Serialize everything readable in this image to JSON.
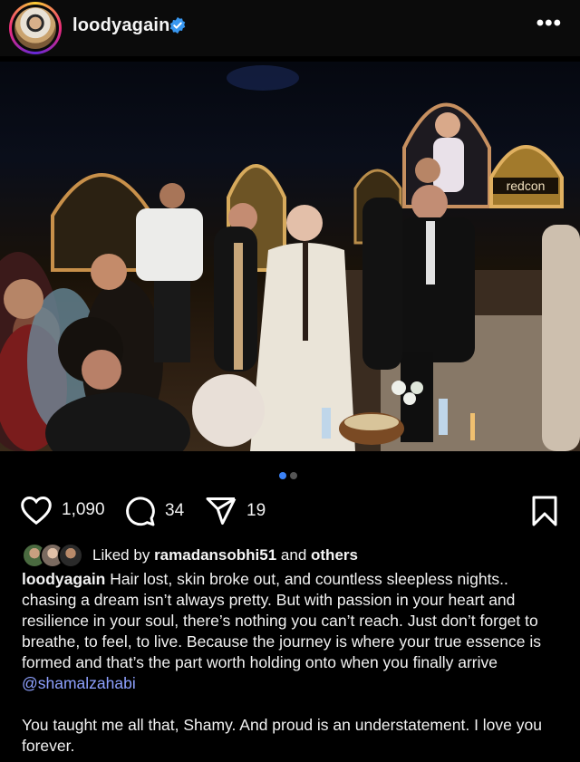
{
  "header": {
    "username": "loodyagain",
    "verified_icon": "verified-badge-icon",
    "more_icon": "more-options-icon",
    "more_label": "•••"
  },
  "photo": {
    "sign_text": "redcon",
    "carousel_count": 2,
    "carousel_active": 1
  },
  "actions": {
    "likes_count": "1,090",
    "comments_count": "34",
    "shares_count": "19"
  },
  "liked_by": {
    "prefix": "Liked by",
    "user": "ramadansobhi51",
    "and": "and",
    "others": "others"
  },
  "caption": {
    "user": "loodyagain",
    "text": " Hair lost, skin broke out, and countless sleepless nights.. chasing a dream isn’t always pretty. But with passion in your heart and resilience in your soul, there’s nothing you can’t reach. Just don’t forget to breathe, to feel, to live. Because the journey is where your true essence is formed and that’s the part worth holding onto when you finally arrive ",
    "mention": "@shamalzahabi",
    "text2": "You taught me all that, Shamy. And proud is an understatement. I love you forever."
  },
  "colors": {
    "background": "#000000",
    "accent_dot": "#3b82f6",
    "mention": "#8ea1ff",
    "verified": "#3897f0"
  }
}
